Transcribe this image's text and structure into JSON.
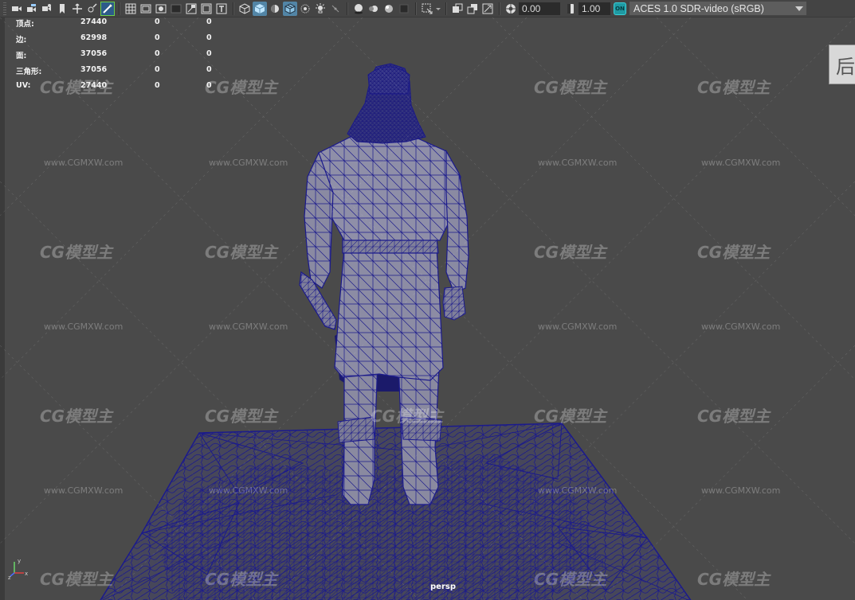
{
  "toolbar": {
    "exposure_value": "0.00",
    "gamma_value": "1.00",
    "color_mgmt_badge": "ON",
    "view_transform": "ACES 1.0 SDR-video (sRGB)",
    "icons": [
      "camera-select-icon",
      "camera-attributes-icon",
      "bookmark-icon",
      "image-plane-icon",
      "2d-pan-zoom-icon",
      "grease-pencil-icon",
      "grid-icon",
      "film-gate-icon",
      "resolution-gate-icon",
      "gate-mask-icon",
      "field-chart-icon",
      "safe-action-icon",
      "safe-title-icon",
      "wireframe-icon",
      "smooth-shade-icon",
      "default-material-icon",
      "wireframe-on-shaded-icon",
      "xray-icon",
      "use-all-lights-icon",
      "shadows-icon",
      "screen-space-ao-icon",
      "motion-blur-icon",
      "anti-aliasing-icon",
      "depth-of-field-icon",
      "isolate-select-icon",
      "xray-joints-icon",
      "xray-active-components-icon",
      "backface-culling-icon",
      "exposure-icon",
      "gamma-icon",
      "color-management-icon"
    ]
  },
  "viewport": {
    "background": "#4a4a4a",
    "wire_color": "#1b1a8c",
    "camera_name": "persp",
    "side_tab_label": "后"
  },
  "hud": {
    "rows": [
      {
        "label": "顶点:",
        "v1": "27440",
        "v2": "0",
        "v3": "0"
      },
      {
        "label": "边:",
        "v1": "62998",
        "v2": "0",
        "v3": "0"
      },
      {
        "label": "面:",
        "v1": "37056",
        "v2": "0",
        "v3": "0"
      },
      {
        "label": "三角形:",
        "v1": "37056",
        "v2": "0",
        "v3": "0"
      },
      {
        "label": "UV:",
        "v1": "27440",
        "v2": "0",
        "v3": "0"
      }
    ]
  },
  "axis": {
    "x": "x",
    "y": "y",
    "z": "z"
  },
  "watermark": {
    "logo": "CG模型主",
    "url": "www.CGMXW.com"
  }
}
